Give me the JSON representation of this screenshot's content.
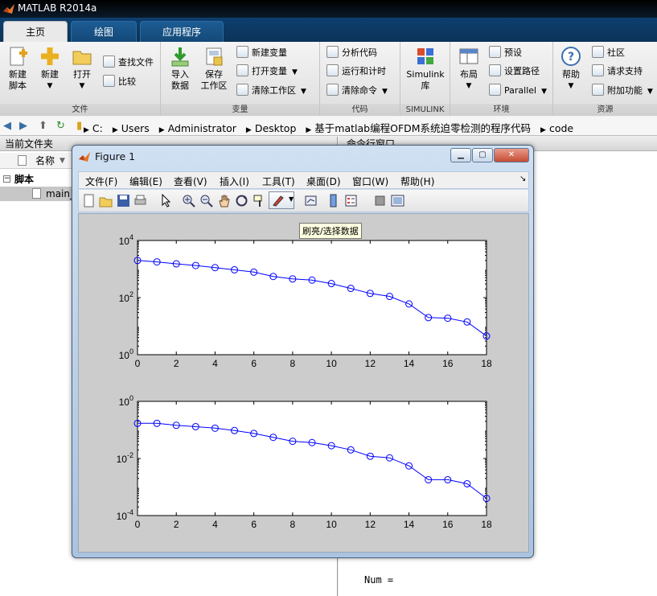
{
  "window": {
    "title": "MATLAB R2014a"
  },
  "tabs": [
    {
      "label": "主页",
      "active": true
    },
    {
      "label": "绘图",
      "active": false
    },
    {
      "label": "应用程序",
      "active": false
    }
  ],
  "ribbon": {
    "file": {
      "caption": "文件",
      "new_script": [
        "新建",
        "脚本"
      ],
      "new": "新建",
      "open": "打开",
      "find_files": "查找文件",
      "compare": "比较"
    },
    "variable": {
      "caption": "变量",
      "import_data": [
        "导入",
        "数据"
      ],
      "save_workspace": [
        "保存",
        "工作区"
      ],
      "new_variable": "新建变量",
      "open_variable": "打开变量",
      "clear_workspace": "清除工作区"
    },
    "code": {
      "caption": "代码",
      "analyze_code": "分析代码",
      "run_and_time": "运行和计时",
      "clear_commands": "清除命令"
    },
    "simulink": {
      "caption": "SIMULINK",
      "library": [
        "Simulink",
        "库"
      ]
    },
    "environment": {
      "caption": "环境",
      "layout": "布局",
      "preferences": "预设",
      "set_path": "设置路径",
      "parallel": "Parallel"
    },
    "resources": {
      "caption": "资源",
      "help": "帮助",
      "community": "社区",
      "request_support": "请求支持",
      "add_ons": "附加功能"
    }
  },
  "address": {
    "crumbs": [
      "C:",
      "Users",
      "Administrator",
      "Desktop",
      "基于matlab编程OFDM系统迫零检测的程序代码",
      "code"
    ]
  },
  "left_panel": {
    "title": "当前文件夹",
    "column_name": "名称",
    "group": "脚本",
    "file": "main_"
  },
  "right_panel": {
    "title": "命令行窗口",
    "output": "Num ="
  },
  "figure": {
    "title": "Figure 1",
    "menus": [
      "文件(F)",
      "编辑(E)",
      "查看(V)",
      "插入(I)",
      "工具(T)",
      "桌面(D)",
      "窗口(W)",
      "帮助(H)"
    ],
    "tooltip": "刷亮/选择数据",
    "colors": {
      "line": "#0000ff",
      "axes_bg": "#ffffff",
      "canvas_bg": "#cccccc"
    }
  },
  "chart_data": [
    {
      "type": "line",
      "xlabel": "",
      "ylabel": "",
      "yscale": "log",
      "xlim": [
        0,
        18
      ],
      "ylim": [
        1,
        10000
      ],
      "xticks": [
        "0",
        "2",
        "4",
        "6",
        "8",
        "10",
        "12",
        "14",
        "16",
        "18"
      ],
      "yticks": [
        {
          "base": "10",
          "exp": "0",
          "v": 1
        },
        {
          "base": "10",
          "exp": "2",
          "v": 100
        },
        {
          "base": "10",
          "exp": "4",
          "v": 10000
        }
      ],
      "x": [
        0,
        1,
        2,
        3,
        4,
        5,
        6,
        7,
        8,
        9,
        10,
        11,
        12,
        13,
        14,
        15,
        16,
        17,
        18
      ],
      "y": [
        2000,
        1780,
        1520,
        1330,
        1120,
        940,
        780,
        550,
        450,
        410,
        310,
        210,
        140,
        110,
        60,
        20,
        19,
        14,
        4.5
      ],
      "marker": "circle"
    },
    {
      "type": "line",
      "xlabel": "",
      "ylabel": "",
      "yscale": "log",
      "xlim": [
        0,
        18
      ],
      "ylim": [
        0.0001,
        1
      ],
      "xticks": [
        "0",
        "2",
        "4",
        "6",
        "8",
        "10",
        "12",
        "14",
        "16",
        "18"
      ],
      "yticks": [
        {
          "base": "10",
          "exp": "-4",
          "v": 0.0001
        },
        {
          "base": "10",
          "exp": "-2",
          "v": 0.01
        },
        {
          "base": "10",
          "exp": "0",
          "v": 1
        }
      ],
      "x": [
        0,
        1,
        2,
        3,
        4,
        5,
        6,
        7,
        8,
        9,
        10,
        11,
        12,
        13,
        14,
        15,
        16,
        17,
        18
      ],
      "y": [
        0.17,
        0.17,
        0.145,
        0.13,
        0.115,
        0.095,
        0.075,
        0.055,
        0.04,
        0.036,
        0.028,
        0.02,
        0.012,
        0.0105,
        0.0055,
        0.0018,
        0.0018,
        0.0013,
        0.0004
      ],
      "marker": "circle"
    }
  ]
}
